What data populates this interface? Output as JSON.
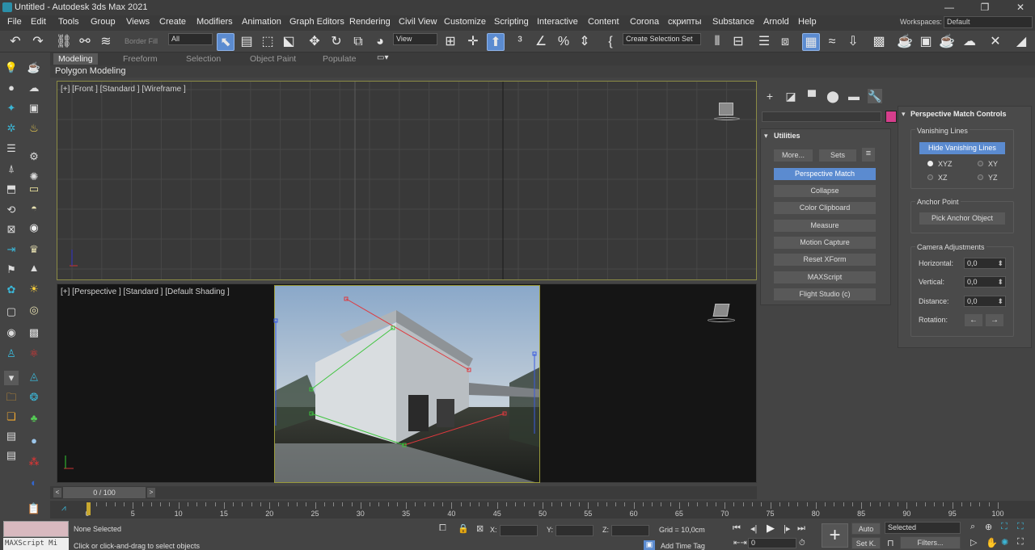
{
  "window": {
    "title": "Untitled - Autodesk 3ds Max 2021",
    "workspaces_label": "Workspaces:",
    "workspace": "Default"
  },
  "menu": [
    "File",
    "Edit",
    "Tools",
    "Group",
    "Views",
    "Create",
    "Modifiers",
    "Animation",
    "Graph Editors",
    "Rendering",
    "Civil View",
    "Customize",
    "Scripting",
    "Interactive",
    "Content",
    "Corona",
    "скрипты",
    "Substance",
    "Arnold",
    "Help"
  ],
  "toolbar": {
    "border_fill": "Border Fill",
    "filter": "All",
    "ref_coord": "View",
    "selection_set": "Create Selection Set"
  },
  "ribbon": {
    "tabs": [
      "Modeling",
      "Freeform",
      "Selection",
      "Object Paint",
      "Populate"
    ],
    "sub_label": "Polygon Modeling"
  },
  "viewports": {
    "front_label": "[+] [Front ] [Standard ] [Wireframe ]",
    "persp_label": "[+] [Perspective ] [Standard ] [Default Shading ]"
  },
  "command_panel": {
    "utilities_title": "Utilities",
    "more_label": "More...",
    "sets_label": "Sets",
    "utilities": [
      "Perspective Match",
      "Collapse",
      "Color Clipboard",
      "Measure",
      "Motion Capture",
      "Reset XForm",
      "MAXScript",
      "Flight Studio (c)"
    ],
    "pm_title": "Perspective Match Controls",
    "vanishing_title": "Vanishing Lines",
    "hide_vanishing": "Hide Vanishing Lines",
    "radios": [
      "XYZ",
      "XY",
      "XZ",
      "YZ"
    ],
    "anchor_title": "Anchor Point",
    "pick_anchor": "Pick Anchor Object",
    "camera_title": "Camera Adjustments",
    "horizontal_label": "Horizontal:",
    "horizontal_value": "0,0",
    "vertical_label": "Vertical:",
    "vertical_value": "0,0",
    "distance_label": "Distance:",
    "distance_value": "0,0",
    "rotation_label": "Rotation:",
    "swatch_color": "#d63e8c"
  },
  "timeline": {
    "frame": "0 / 100",
    "ticks": [
      "0",
      "5",
      "10",
      "15",
      "20",
      "25",
      "30",
      "35",
      "40",
      "45",
      "50",
      "55",
      "60",
      "65",
      "70",
      "75",
      "80",
      "85",
      "90",
      "95",
      "100"
    ]
  },
  "status": {
    "maxscript": "MAXScript Mi",
    "selection": "None Selected",
    "prompt": "Click or click-and-drag to select objects",
    "x_label": "X:",
    "y_label": "Y:",
    "z_label": "Z:",
    "grid": "Grid = 10,0cm",
    "add_time_tag": "Add Time Tag",
    "auto": "Auto",
    "setk": "Set K.",
    "selected": "Selected",
    "filters": "Filters...",
    "frame_field": "0"
  }
}
